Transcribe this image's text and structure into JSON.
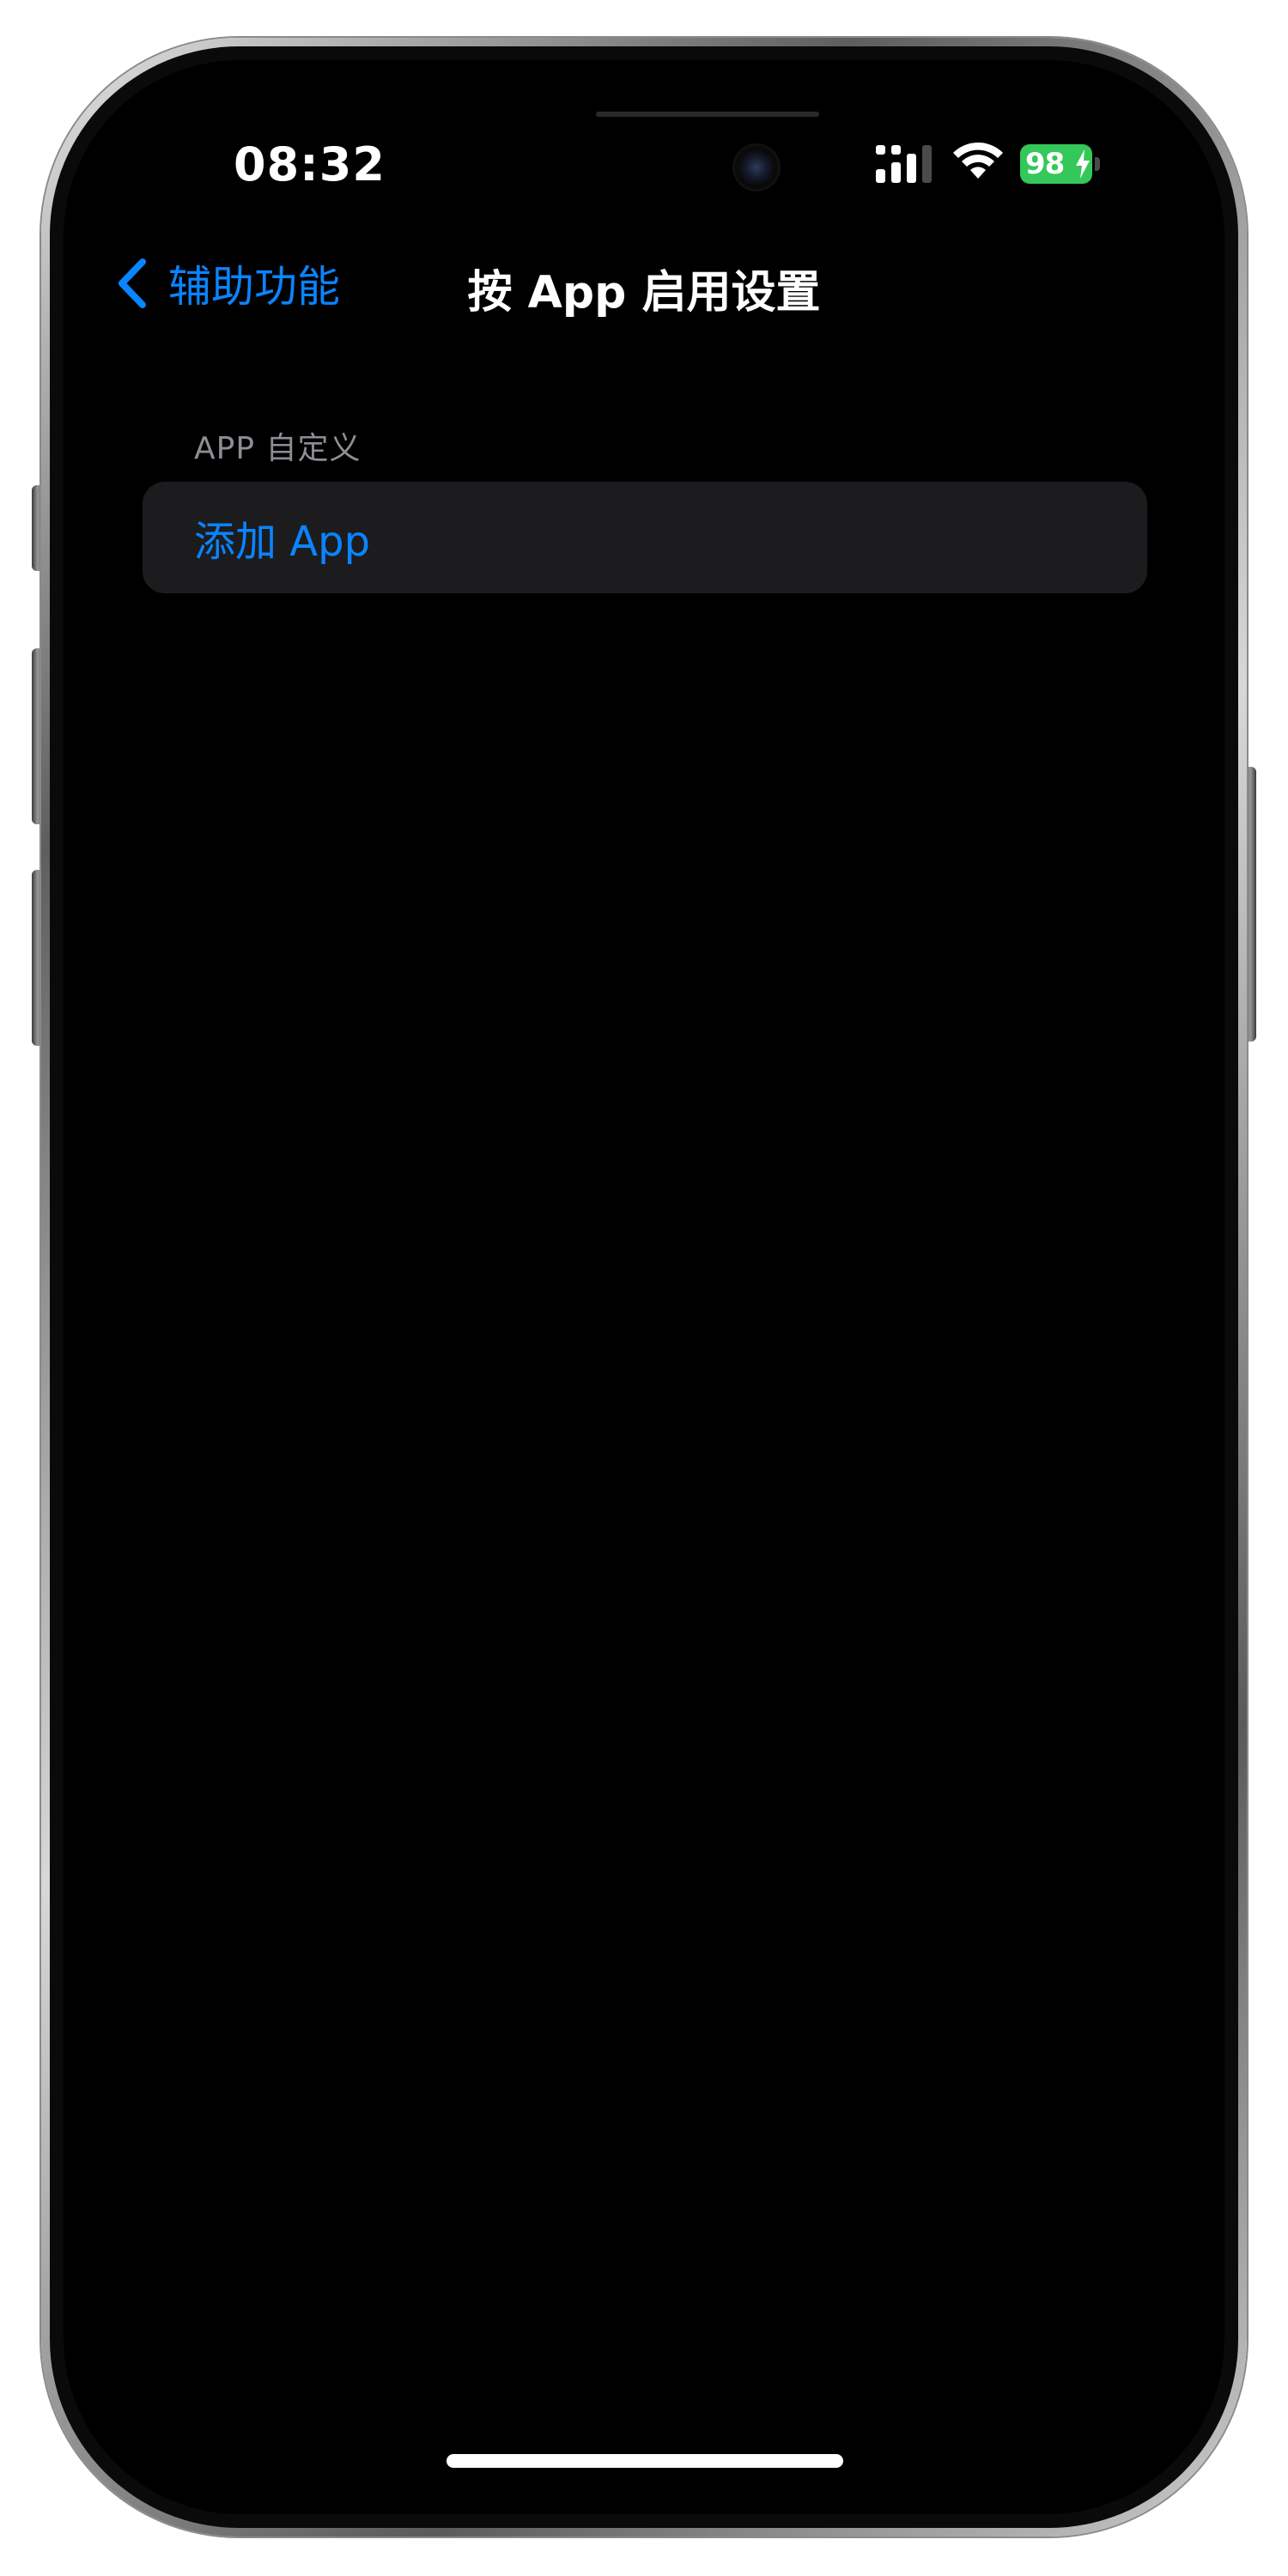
{
  "status_bar": {
    "time": "08:32",
    "battery_percent": "98",
    "battery_color": "#34c759",
    "icons": [
      "cellular-signal-icon",
      "wifi-icon",
      "battery-charging-icon"
    ]
  },
  "nav": {
    "back_label": "辅助功能",
    "title": "按 App 启用设置",
    "back_icon": "chevron-left-icon"
  },
  "section": {
    "header": "APP 自定义",
    "add_app_label": "添加 App"
  },
  "colors": {
    "accent": "#0a84ff",
    "background": "#000000",
    "cell_background": "#1c1c1e",
    "secondary_text": "#8d8d93"
  }
}
